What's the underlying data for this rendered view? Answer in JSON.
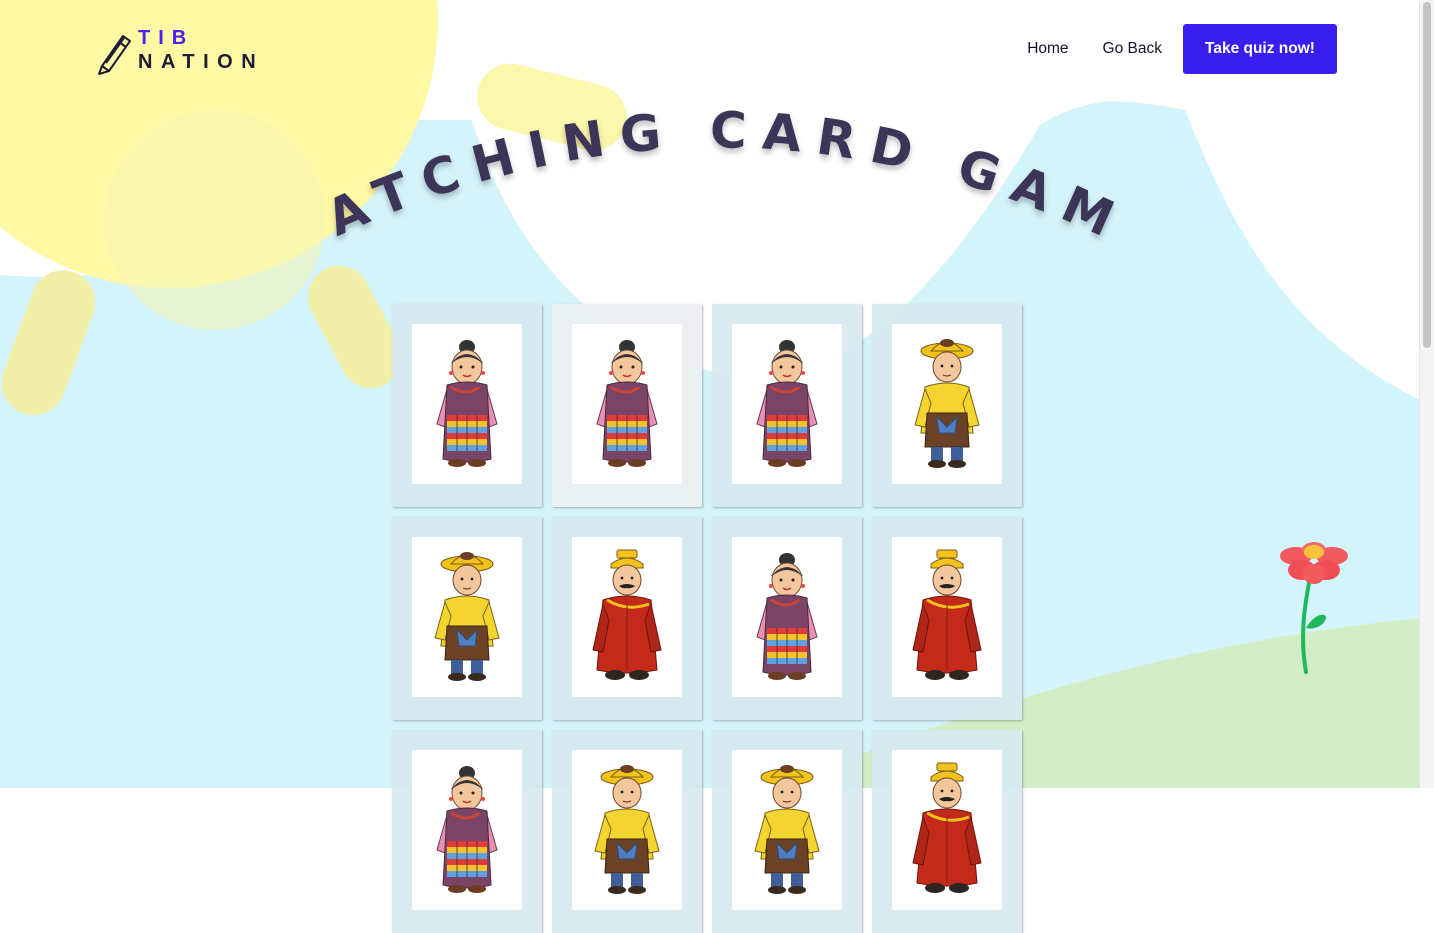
{
  "header": {
    "logo_line1": "TIB",
    "logo_line2": "NATION",
    "nav": {
      "home": "Home",
      "go_back": "Go Back",
      "quiz_button": "Take quiz now!"
    }
  },
  "title": "MATCHING CARD GAME",
  "colors": {
    "accent": "#3a1ef0",
    "title": "#3d3658",
    "sky": "#d4f4fb",
    "sun": "#fff7a6",
    "hill": "#d3eec6"
  },
  "board": {
    "cards": [
      {
        "figure": "woman-in-chuba"
      },
      {
        "figure": "woman-in-chuba"
      },
      {
        "figure": "woman-in-chuba"
      },
      {
        "figure": "man-yellow-hat"
      },
      {
        "figure": "man-yellow-hat"
      },
      {
        "figure": "man-red-robe"
      },
      {
        "figure": "woman-in-chuba"
      },
      {
        "figure": "man-red-robe"
      },
      {
        "figure": "woman-in-chuba"
      },
      {
        "figure": "man-yellow-hat"
      },
      {
        "figure": "man-yellow-hat"
      },
      {
        "figure": "man-red-robe"
      }
    ]
  },
  "decor": {
    "flower_icon": "flower-icon",
    "pencil_icon": "pencil-icon"
  }
}
